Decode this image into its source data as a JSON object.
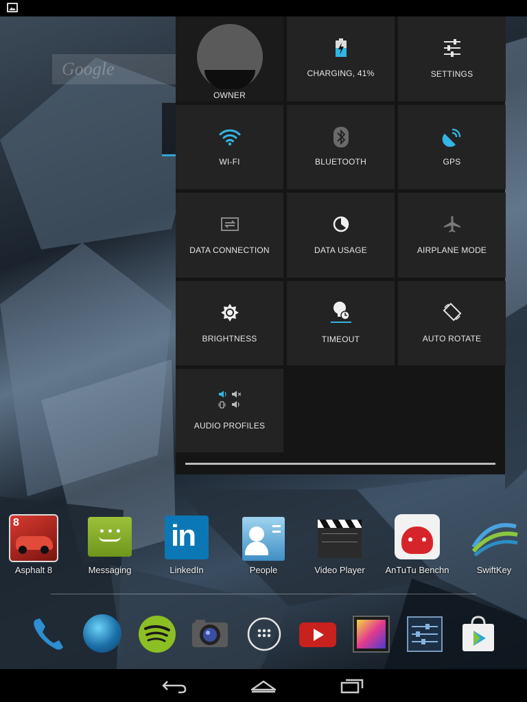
{
  "status_bar": {
    "notification_icon": "image-notification-icon"
  },
  "home_widget": {
    "google_text": "Google"
  },
  "quick_settings": {
    "tiles": [
      {
        "label": "OWNER",
        "icon": "user-avatar-icon"
      },
      {
        "label": "CHARGING, 41%",
        "icon": "battery-charging-icon",
        "battery_level": 41
      },
      {
        "label": "SETTINGS",
        "icon": "sliders-icon"
      },
      {
        "label": "WI-FI",
        "icon": "wifi-icon"
      },
      {
        "label": "BLUETOOTH",
        "icon": "bluetooth-icon"
      },
      {
        "label": "GPS",
        "icon": "gps-icon"
      },
      {
        "label": "DATA CONNECTION",
        "icon": "data-connection-icon"
      },
      {
        "label": "DATA USAGE",
        "icon": "data-usage-icon"
      },
      {
        "label": "AIRPLANE MODE",
        "icon": "airplane-icon"
      },
      {
        "label": "BRIGHTNESS",
        "icon": "brightness-icon"
      },
      {
        "label": "TIMEOUT",
        "icon": "timeout-icon"
      },
      {
        "label": "AUTO ROTATE",
        "icon": "auto-rotate-icon"
      },
      {
        "label": "AUDIO PROFILES",
        "icon": "audio-profiles-icon"
      }
    ]
  },
  "apps": [
    {
      "label": "Asphalt 8",
      "icon": "asphalt-8-icon"
    },
    {
      "label": "Messaging",
      "icon": "messaging-icon"
    },
    {
      "label": "LinkedIn",
      "icon": "linkedin-icon"
    },
    {
      "label": "People",
      "icon": "people-icon"
    },
    {
      "label": "Video Player",
      "icon": "video-player-icon"
    },
    {
      "label": "AnTuTu Benchn",
      "icon": "antutu-icon"
    },
    {
      "label": "SwiftKey",
      "icon": "swiftkey-icon"
    }
  ],
  "dock": [
    {
      "name": "phone-icon"
    },
    {
      "name": "browser-icon"
    },
    {
      "name": "spotify-icon"
    },
    {
      "name": "camera-icon"
    },
    {
      "name": "all-apps-icon"
    },
    {
      "name": "youtube-icon"
    },
    {
      "name": "gallery-icon"
    },
    {
      "name": "settings-app-icon"
    },
    {
      "name": "play-store-icon"
    }
  ],
  "colors": {
    "accent_blue": "#33b5e5",
    "tile_bg": "#232323",
    "panel_bg": "#151515"
  }
}
